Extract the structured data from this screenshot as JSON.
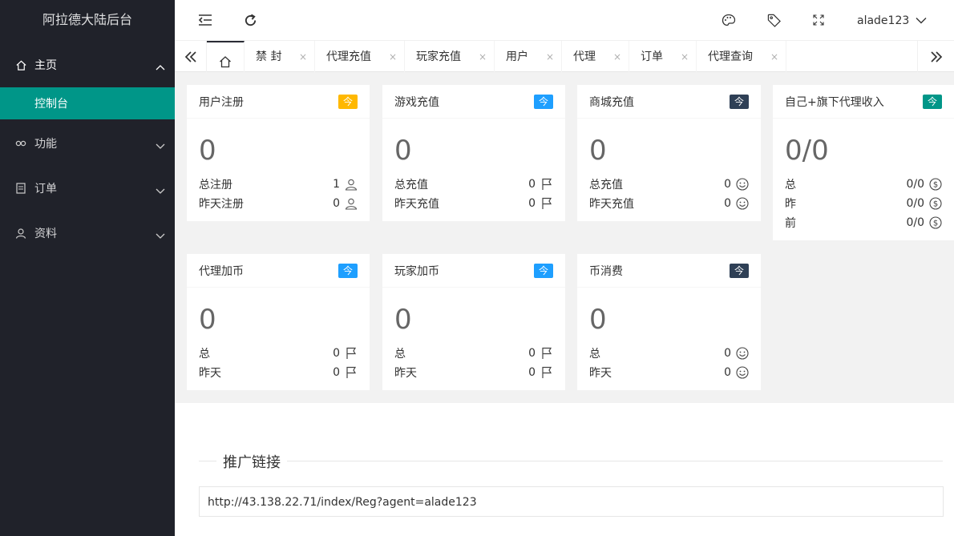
{
  "app": {
    "title": "阿拉德大陆后台"
  },
  "sidebar": {
    "home": {
      "label": "主页",
      "icon": "home-icon"
    },
    "console": {
      "label": "控制台"
    },
    "items": [
      {
        "label": "功能",
        "icon": "link-icon"
      },
      {
        "label": "订单",
        "icon": "document-icon"
      },
      {
        "label": "资料",
        "icon": "user-icon"
      }
    ]
  },
  "header": {
    "user": "alade123",
    "icons": [
      "menu-collapse-icon",
      "refresh-icon",
      "theme-icon",
      "tag-icon",
      "fullscreen-icon"
    ]
  },
  "tabs": {
    "items": [
      {
        "label": "禁 封"
      },
      {
        "label": "代理充值"
      },
      {
        "label": "玩家充值"
      },
      {
        "label": "用户"
      },
      {
        "label": "代理"
      },
      {
        "label": "订单"
      },
      {
        "label": "代理查询"
      }
    ],
    "close": "×"
  },
  "cards": [
    {
      "title": "用户注册",
      "badge": "今",
      "badge_color": "#ffb800",
      "value": "0",
      "rows": [
        {
          "label": "总注册",
          "value": "1"
        },
        {
          "label": "昨天注册",
          "value": "0"
        }
      ]
    },
    {
      "title": "游戏充值",
      "badge": "今",
      "badge_color": "#1e9fff",
      "value": "0",
      "rows": [
        {
          "label": "总充值",
          "value": "0"
        },
        {
          "label": "昨天充值",
          "value": "0"
        }
      ]
    },
    {
      "title": "商城充值",
      "badge": "今",
      "badge_color": "#2f4056",
      "value": "0",
      "rows": [
        {
          "label": "总充值",
          "value": "0"
        },
        {
          "label": "昨天充值",
          "value": "0"
        }
      ]
    },
    {
      "title": "自己+旗下代理收入",
      "badge": "今",
      "badge_color": "#009688",
      "value": "0/0",
      "rows": [
        {
          "label": "总",
          "value": "0/0"
        },
        {
          "label": "昨",
          "value": "0/0"
        },
        {
          "label": "前",
          "value": "0/0"
        }
      ]
    },
    {
      "title": "代理加币",
      "badge": "今",
      "badge_color": "#1e9fff",
      "value": "0",
      "rows": [
        {
          "label": "总",
          "value": "0"
        },
        {
          "label": "昨天",
          "value": "0"
        }
      ]
    },
    {
      "title": "玩家加币",
      "badge": "今",
      "badge_color": "#1e9fff",
      "value": "0",
      "rows": [
        {
          "label": "总",
          "value": "0"
        },
        {
          "label": "昨天",
          "value": "0"
        }
      ]
    },
    {
      "title": "币消费",
      "badge": "今",
      "badge_color": "#2f4056",
      "value": "0",
      "rows": [
        {
          "label": "总",
          "value": "0"
        },
        {
          "label": "昨天",
          "value": "0"
        }
      ]
    }
  ],
  "promo": {
    "title": "推广链接",
    "url": "http://43.138.22.71/index/Reg?agent=alade123"
  }
}
